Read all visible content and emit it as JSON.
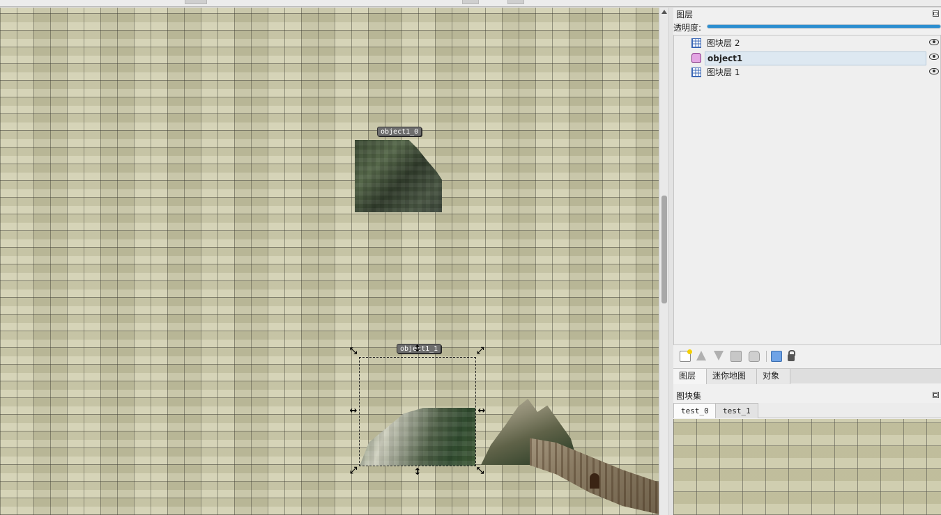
{
  "map": {
    "objects": [
      {
        "label": "object1_0"
      },
      {
        "label": "object1_1"
      }
    ]
  },
  "layers_dock": {
    "title": "图层",
    "opacity_label": "透明度:",
    "opacity_value": 1.0,
    "layers": [
      {
        "name": "图块层 2",
        "type": "tile-layer",
        "visible": true,
        "selected": false
      },
      {
        "name": "object1",
        "type": "object-layer",
        "visible": true,
        "selected": true
      },
      {
        "name": "图块层 1",
        "type": "tile-layer",
        "visible": true,
        "selected": false
      }
    ],
    "toolbar": [
      "new-layer-icon",
      "raise-layer-icon",
      "lower-layer-icon",
      "duplicate-layer-icon",
      "remove-layer-icon",
      "show-other-layers-icon",
      "lock-layer-icon"
    ]
  },
  "dock_tabs": [
    {
      "label": "图层",
      "active": true
    },
    {
      "label": "迷你地图",
      "active": false
    },
    {
      "label": "对象",
      "active": false
    }
  ],
  "tilesets_dock": {
    "title": "图块集",
    "tabs": [
      {
        "label": "test_0",
        "active": true
      },
      {
        "label": "test_1",
        "active": false
      }
    ]
  },
  "colors": {
    "accent": "#2b8ed0",
    "selection": "#dde8f1"
  }
}
